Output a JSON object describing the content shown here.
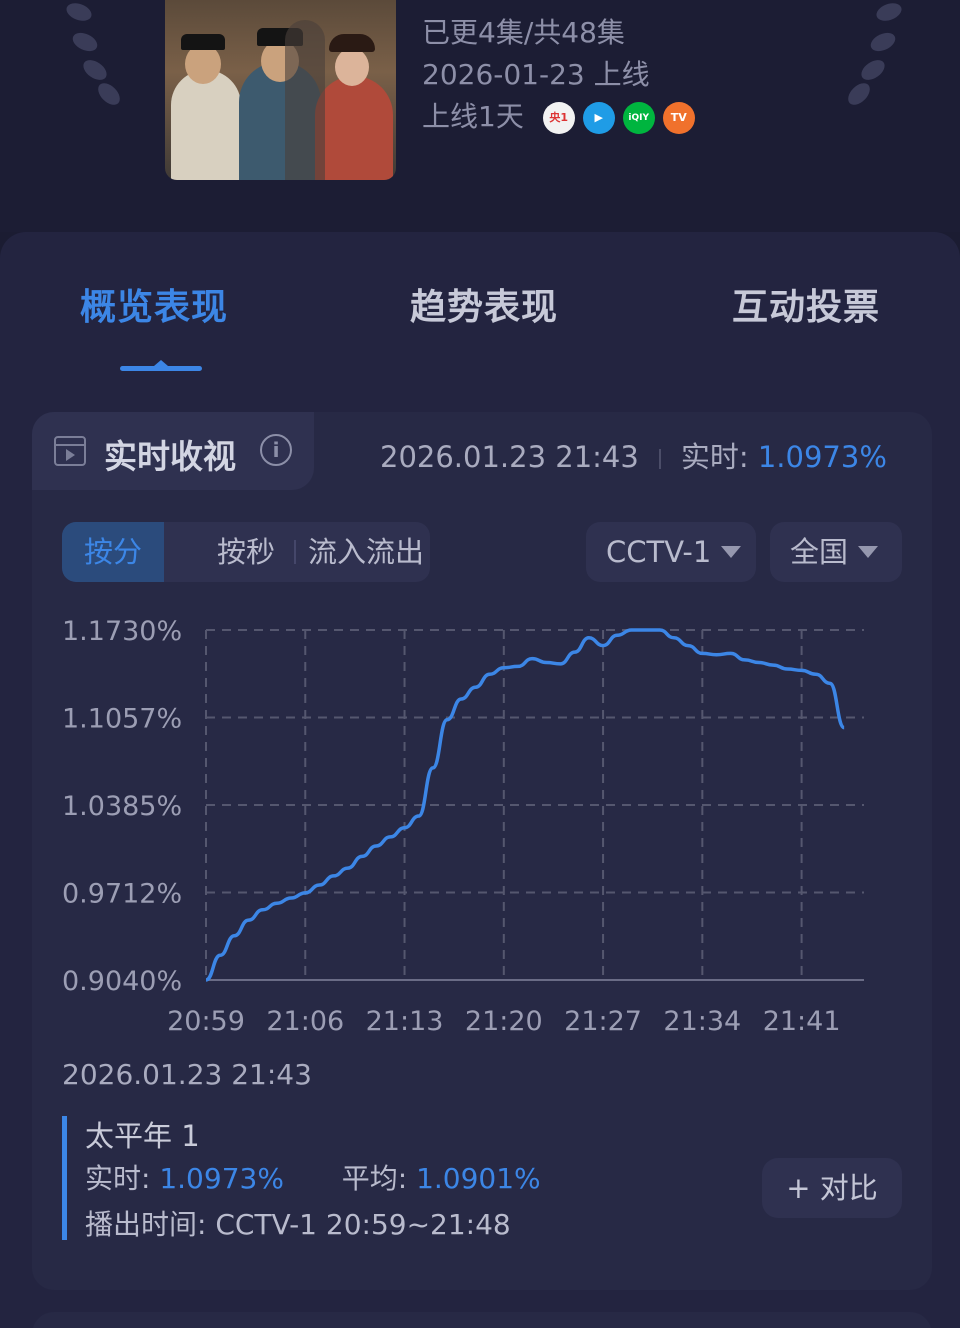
{
  "show": {
    "episodes_text": "已更4集/共48集",
    "release_date": "2026-01-23 上线",
    "online_days": "上线1天",
    "platforms": [
      {
        "name": "cctv1-icon",
        "label": "央1",
        "color": "#e04a5a"
      },
      {
        "name": "tencent-video-icon",
        "label": "▶",
        "color": "#1f9ce6"
      },
      {
        "name": "iqiyi-icon",
        "label": "iQIY",
        "color": "#00b53f"
      },
      {
        "name": "mango-tv-icon",
        "label": "TV",
        "color": "#f0712c"
      }
    ]
  },
  "tabs": [
    {
      "label": "概览表现",
      "active": true
    },
    {
      "label": "趋势表现",
      "active": false
    },
    {
      "label": "互动投票",
      "active": false
    }
  ],
  "realtime_card": {
    "title": "实时收视",
    "info_icon": "i",
    "timestamp": "2026.01.23 21:43",
    "realtime_label": "实时:",
    "realtime_value": "1.0973%"
  },
  "segments": [
    "按分",
    "按秒",
    "流入流出"
  ],
  "active_segment": "按分",
  "channel_select": "CCTV-1",
  "region_select": "全国",
  "accent_color": "#3c86e6",
  "chart_data": {
    "type": "line",
    "y_ticks": [
      "1.1730%",
      "1.1057%",
      "1.0385%",
      "0.9712%",
      "0.9040%"
    ],
    "x_ticks": [
      "20:59",
      "21:06",
      "21:13",
      "21:20",
      "21:27",
      "21:34",
      "21:41"
    ],
    "ylim": [
      0.904,
      1.173
    ],
    "grid": true,
    "series": [
      {
        "x": [
          "20:59",
          "21:00",
          "21:01",
          "21:02",
          "21:03",
          "21:04",
          "21:05",
          "21:06",
          "21:07",
          "21:08",
          "21:09",
          "21:10",
          "21:11",
          "21:12",
          "21:13",
          "21:14",
          "21:15",
          "21:16",
          "21:17",
          "21:18",
          "21:19",
          "21:20",
          "21:21",
          "21:22",
          "21:23",
          "21:24",
          "21:25",
          "21:26",
          "21:27",
          "21:28",
          "21:29",
          "21:30",
          "21:31",
          "21:32",
          "21:33",
          "21:34",
          "21:35",
          "21:36",
          "21:37",
          "21:38",
          "21:39",
          "21:40",
          "21:41",
          "21:42",
          "21:43",
          "21:44"
        ],
        "values": [
          0.904,
          0.923,
          0.938,
          0.95,
          0.958,
          0.963,
          0.967,
          0.971,
          0.977,
          0.984,
          0.99,
          0.999,
          1.007,
          1.014,
          1.021,
          1.03,
          1.067,
          1.104,
          1.12,
          1.129,
          1.139,
          1.144,
          1.145,
          1.151,
          1.148,
          1.147,
          1.156,
          1.167,
          1.161,
          1.169,
          1.173,
          1.173,
          1.173,
          1.167,
          1.161,
          1.155,
          1.154,
          1.155,
          1.15,
          1.148,
          1.146,
          1.143,
          1.142,
          1.139,
          1.132,
          1.098
        ]
      }
    ]
  },
  "detail": {
    "timestamp": "2026.01.23 21:43",
    "program": "太平年 1",
    "realtime_label": "实时:",
    "realtime_value": "1.0973%",
    "average_label": "平均:",
    "average_value": "1.0901%",
    "airtime_label": "播出时间:",
    "airtime_value": "CCTV-1 20:59~21:48"
  },
  "compare_button": "+ 对比"
}
